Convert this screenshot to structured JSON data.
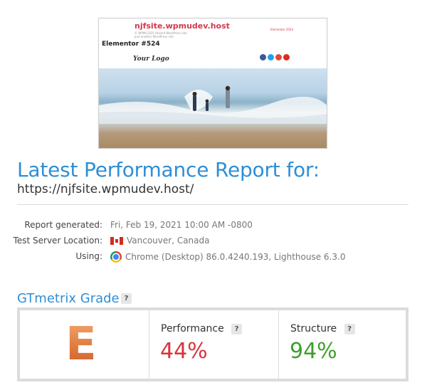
{
  "thumbnail": {
    "site_title": "njfsite.wpmudev.host",
    "site_tagline": "© WPMU DEV Hosted WordPress site",
    "site_tagline2": "Just another WordPress site",
    "header_link": "Elementor 2024",
    "page_title": "Elementor #524",
    "logo_text": "Your Logo",
    "social_colors": [
      "#3b5998",
      "#1da1f2",
      "#dd4b39",
      "#e02a20"
    ]
  },
  "report": {
    "title": "Latest Performance Report for:",
    "url": "https://njfsite.wpmudev.host/"
  },
  "meta": {
    "generated_label": "Report generated:",
    "generated_value": "Fri, Feb 19, 2021 10:00 AM -0800",
    "location_label": "Test Server Location:",
    "location_value": "Vancouver, Canada",
    "using_label": "Using:",
    "using_value": "Chrome (Desktop) 86.0.4240.193, Lighthouse 6.3.0"
  },
  "grade": {
    "heading": "GTmetrix Grade",
    "help": "?",
    "letter": "E",
    "performance_label": "Performance",
    "performance_value": "44%",
    "structure_label": "Structure",
    "structure_value": "94%"
  },
  "colors": {
    "accent": "#2f8ed6",
    "performance": "#d6353b",
    "structure": "#3f9f2c",
    "grade_e": "#e07a3e"
  }
}
